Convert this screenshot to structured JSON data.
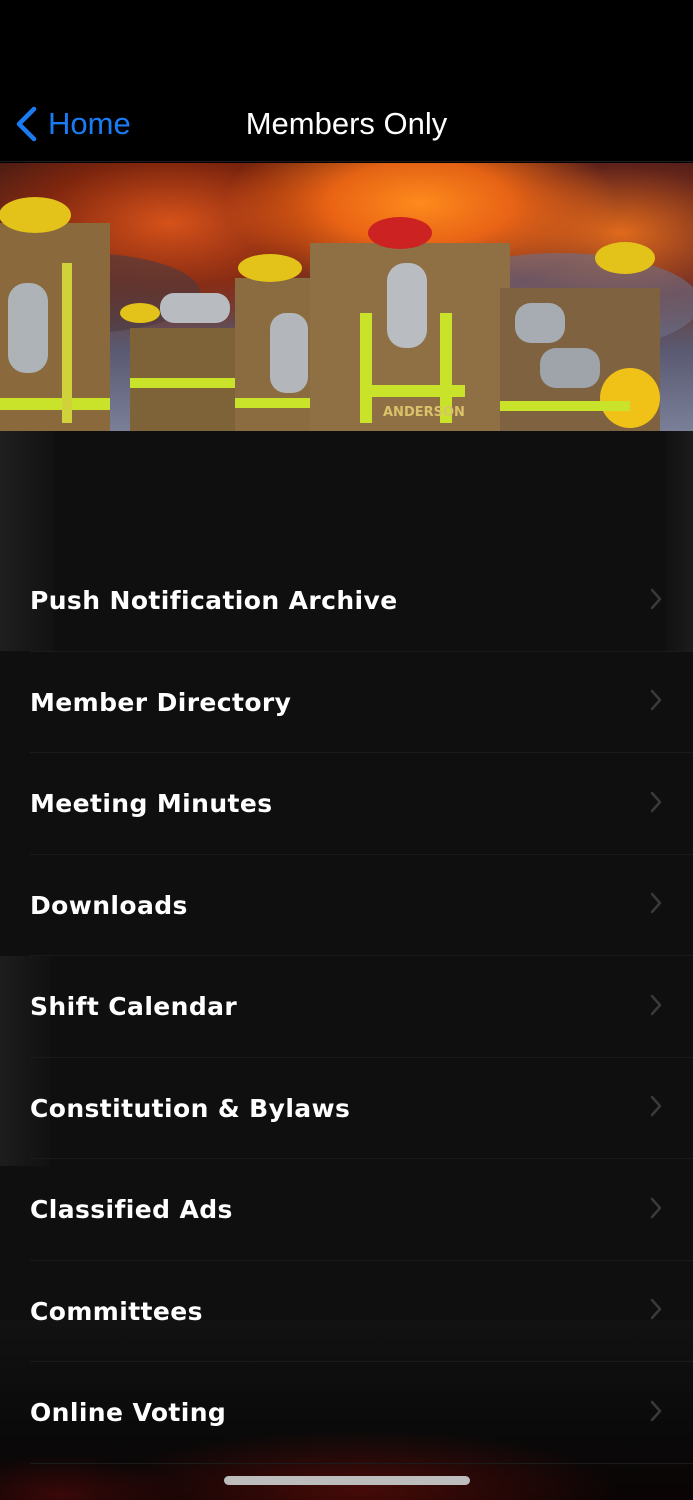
{
  "nav": {
    "back_label": "Home",
    "title": "Members Only"
  },
  "hero": {
    "image": "firefighters-at-fire-photo",
    "visible_text": [
      "ANDERSON"
    ]
  },
  "menu": {
    "items": [
      {
        "label": "Push Notification Archive",
        "icon": "chevron-right-icon"
      },
      {
        "label": "Member Directory",
        "icon": "chevron-right-icon"
      },
      {
        "label": "Meeting Minutes",
        "icon": "chevron-right-icon"
      },
      {
        "label": "Downloads",
        "icon": "chevron-right-icon"
      },
      {
        "label": "Shift Calendar",
        "icon": "chevron-right-icon"
      },
      {
        "label": "Constitution & Bylaws",
        "icon": "chevron-right-icon"
      },
      {
        "label": "Classified Ads",
        "icon": "chevron-right-icon"
      },
      {
        "label": "Committees",
        "icon": "chevron-right-icon"
      },
      {
        "label": "Online Voting",
        "icon": "chevron-right-icon"
      }
    ]
  },
  "colors": {
    "accent": "#1a7cf5",
    "background": "#000000",
    "list_background": "#0f0f0f"
  }
}
